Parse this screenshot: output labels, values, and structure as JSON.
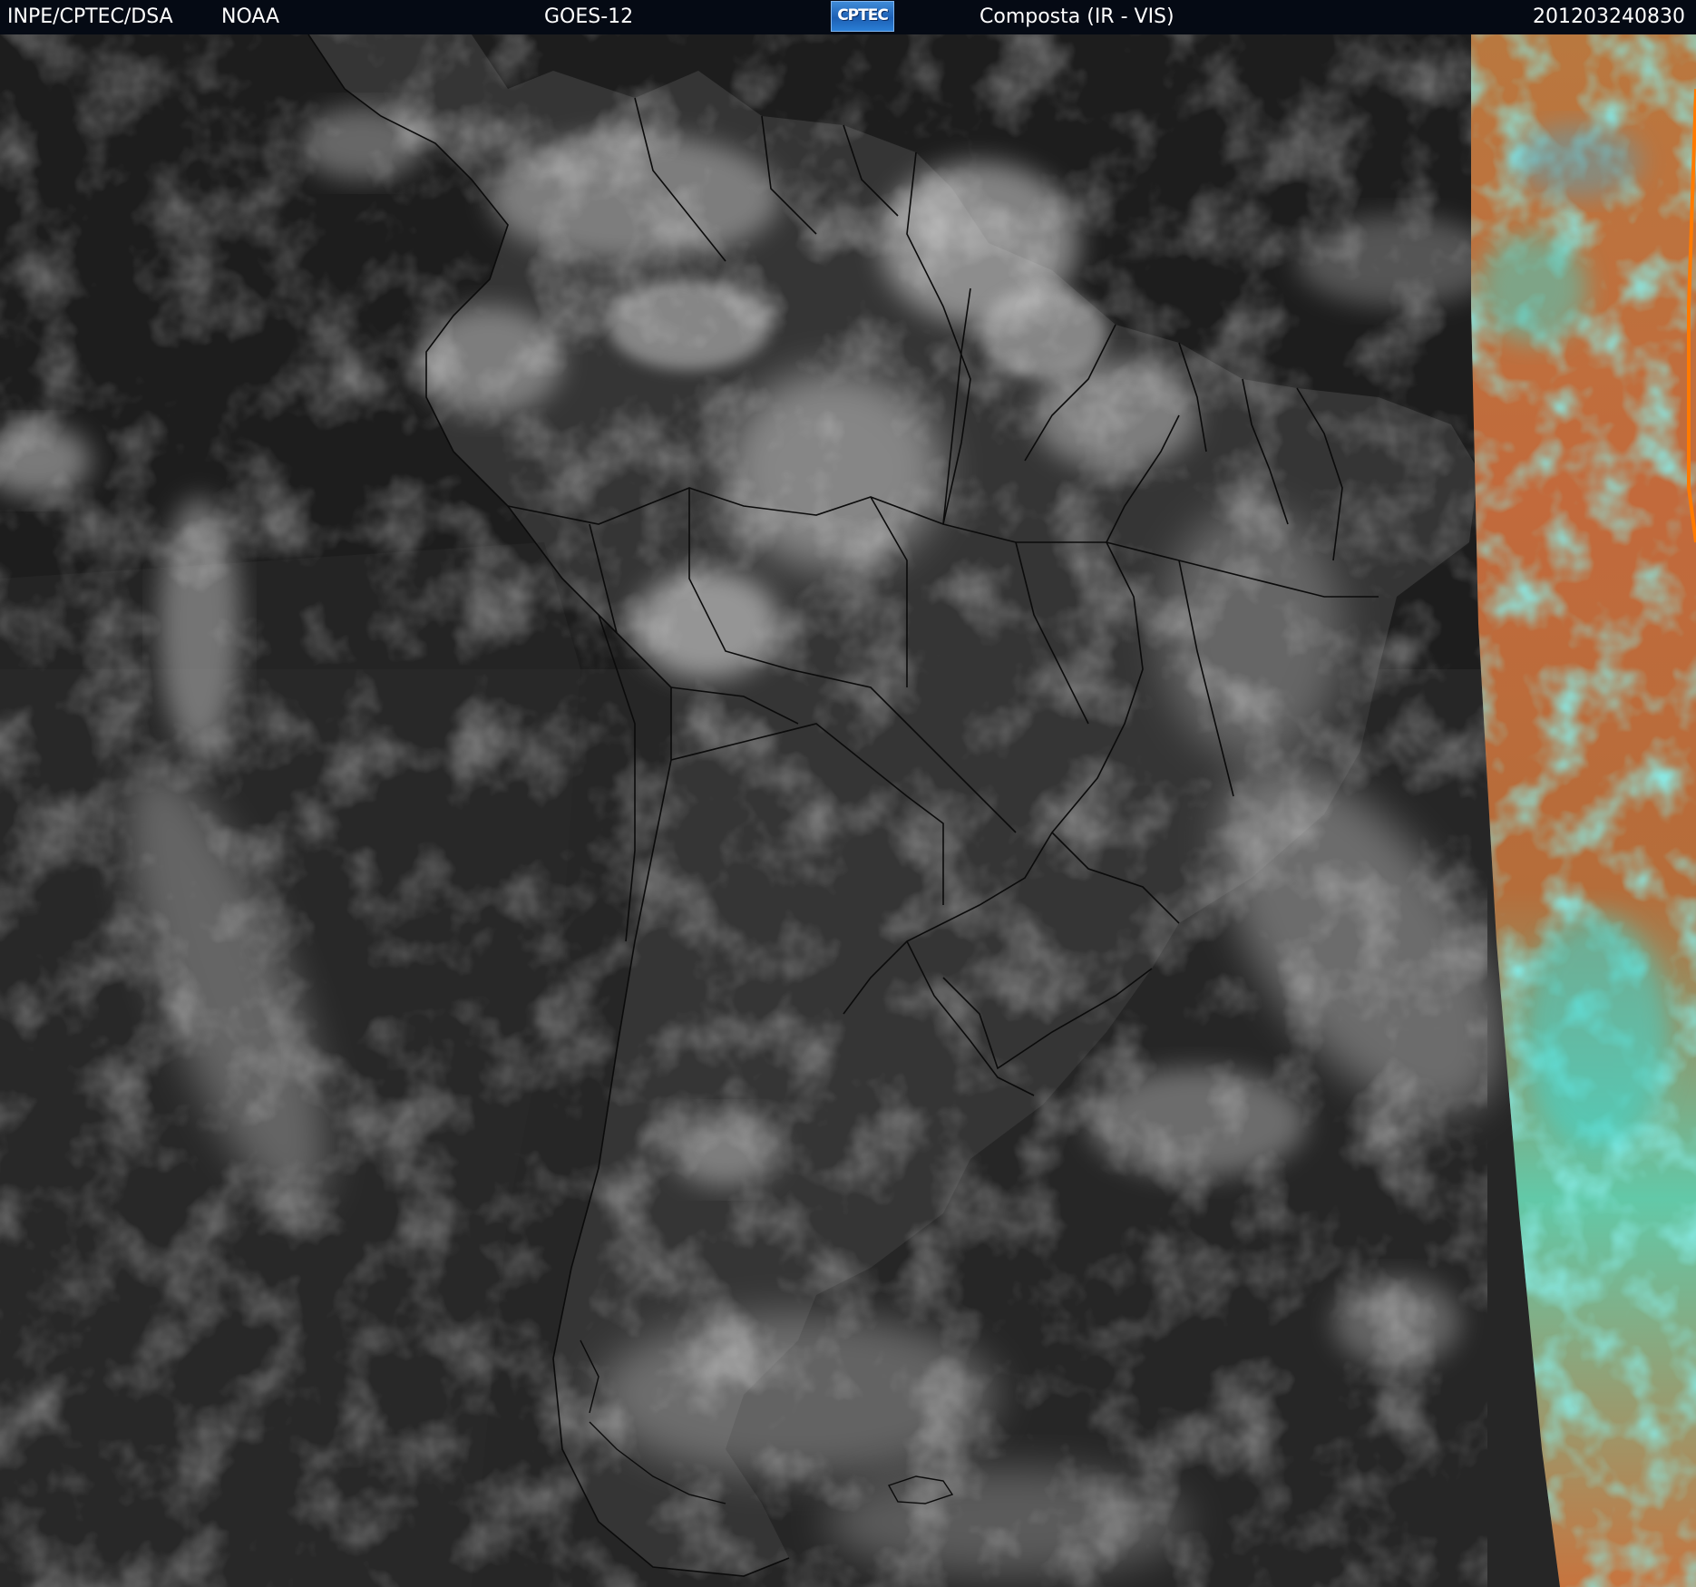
{
  "header": {
    "source": "INPE/CPTEC/DSA",
    "agency": "NOAA",
    "satellite": "GOES-12",
    "logo_text": "CPTEC",
    "product": "Composta (IR - VIS)",
    "timestamp": "201203240830"
  },
  "map": {
    "region": "south-america",
    "colors": {
      "ocean_base": "#1b1b1b",
      "land_base": "#3a3a3a",
      "cloud": "#e8e8e8",
      "border_line": "#0a0a0a",
      "swath_warm": "#c96b3c",
      "swath_cool": "#3fd8d0",
      "swath_edge": "#ff7a00"
    }
  }
}
